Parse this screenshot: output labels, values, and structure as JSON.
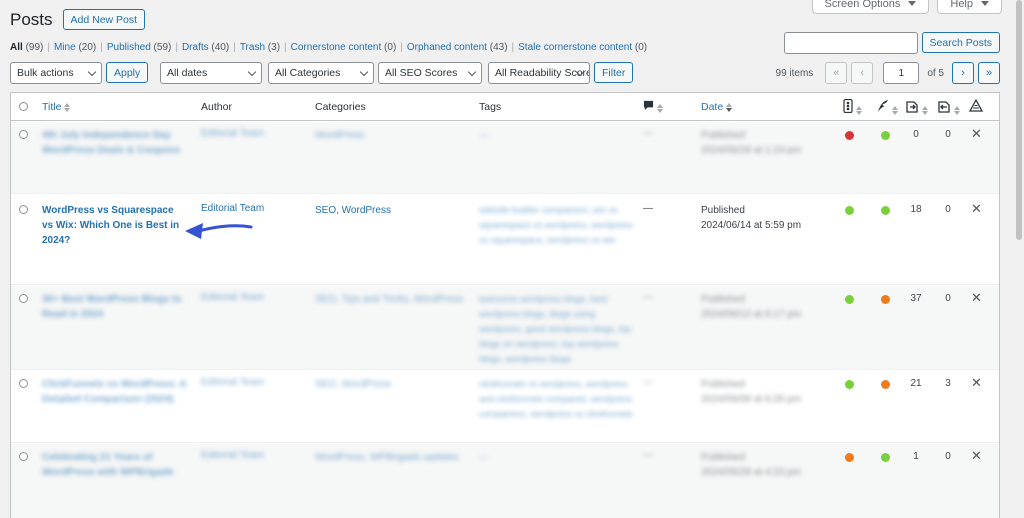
{
  "header": {
    "title": "Posts",
    "add_new": "Add New Post",
    "screen_options": "Screen Options",
    "help": "Help"
  },
  "views": [
    {
      "label": "All",
      "count": "(99)",
      "current": true
    },
    {
      "label": "Mine",
      "count": "(20)"
    },
    {
      "label": "Published",
      "count": "(59)"
    },
    {
      "label": "Drafts",
      "count": "(40)"
    },
    {
      "label": "Trash",
      "count": "(3)"
    },
    {
      "label": "Cornerstone content",
      "count": "(0)"
    },
    {
      "label": "Orphaned content",
      "count": "(43)"
    },
    {
      "label": "Stale cornerstone content",
      "count": "(0)"
    }
  ],
  "search": {
    "button": "Search Posts",
    "value": ""
  },
  "tablenav": {
    "bulk_actions": "Bulk actions",
    "apply": "Apply",
    "dates": "All dates",
    "categories": "All Categories",
    "seo_scores": "All SEO Scores",
    "readability": "All Readability Scores",
    "filter": "Filter",
    "items": "99 items",
    "first": "«",
    "prev": "‹",
    "current_page": "1",
    "of": "of 5",
    "next": "›",
    "last": "»"
  },
  "columns": {
    "title": "Title",
    "author": "Author",
    "categories": "Categories",
    "tags": "Tags",
    "date": "Date"
  },
  "colors": {
    "red": "#d63638",
    "green": "#7ad03a",
    "orange": "#ee7c1b"
  },
  "rows": [
    {
      "title": "4th July Independence Day WordPress Deals & Coupons",
      "author": "Editorial Team",
      "categories": "WordPress",
      "tags": "—",
      "comments": "—",
      "status": "Published",
      "date": "2024/06/28 at 1:23 pm",
      "seo": "red",
      "readability": "green",
      "links_out": "0",
      "links_in": "0",
      "blurred": true
    },
    {
      "title": "WordPress vs Squarespace vs Wix: Which One is Best in 2024?",
      "author": "Editorial Team",
      "categories": "SEO, WordPress",
      "tags": "website builder comparison, wix vs squarespace vs wordpress, wordpress vs squarespace, wordpress vs wix",
      "comments": "—",
      "status": "Published",
      "date": "2024/06/14 at 5:59 pm",
      "seo": "green",
      "readability": "green",
      "links_out": "18",
      "links_in": "0",
      "blurred": false
    },
    {
      "title": "30+ Best WordPress Blogs to Read in 2024",
      "author": "Editorial Team",
      "categories": "SEO, Tips and Tricks, WordPress",
      "tags": "awesome wordpress blogs, best wordpress blogs, blogs using wordpress, good wordpress blogs, top blogs on wordpress, top wordpress blogs, wordpress blogs",
      "comments": "—",
      "status": "Published",
      "date": "2024/06/12 at 6:17 pm",
      "seo": "green",
      "readability": "orange",
      "links_out": "37",
      "links_in": "0",
      "blurred": true
    },
    {
      "title": "ClickFunnels vs WordPress: A Detailed Comparison (2024)",
      "author": "Editorial Team",
      "categories": "SEO, WordPress",
      "tags": "clickfunnels vs wordpress, wordpress and clickfunnels compared, wordpress comparison, wordpress vs clickfunnels",
      "comments": "—",
      "status": "Published",
      "date": "2024/06/08 at 6:26 pm",
      "seo": "green",
      "readability": "orange",
      "links_out": "21",
      "links_in": "3",
      "blurred": true
    },
    {
      "title": "Celebrating 21 Years of WordPress with WPBrigade",
      "author": "Editorial Team",
      "categories": "WordPress, WPBrigade updates",
      "tags": "—",
      "comments": "—",
      "status": "Published",
      "date": "2024/05/28 at 4:23 pm",
      "seo": "orange",
      "readability": "green",
      "links_out": "1",
      "links_in": "0",
      "blurred": true
    }
  ]
}
